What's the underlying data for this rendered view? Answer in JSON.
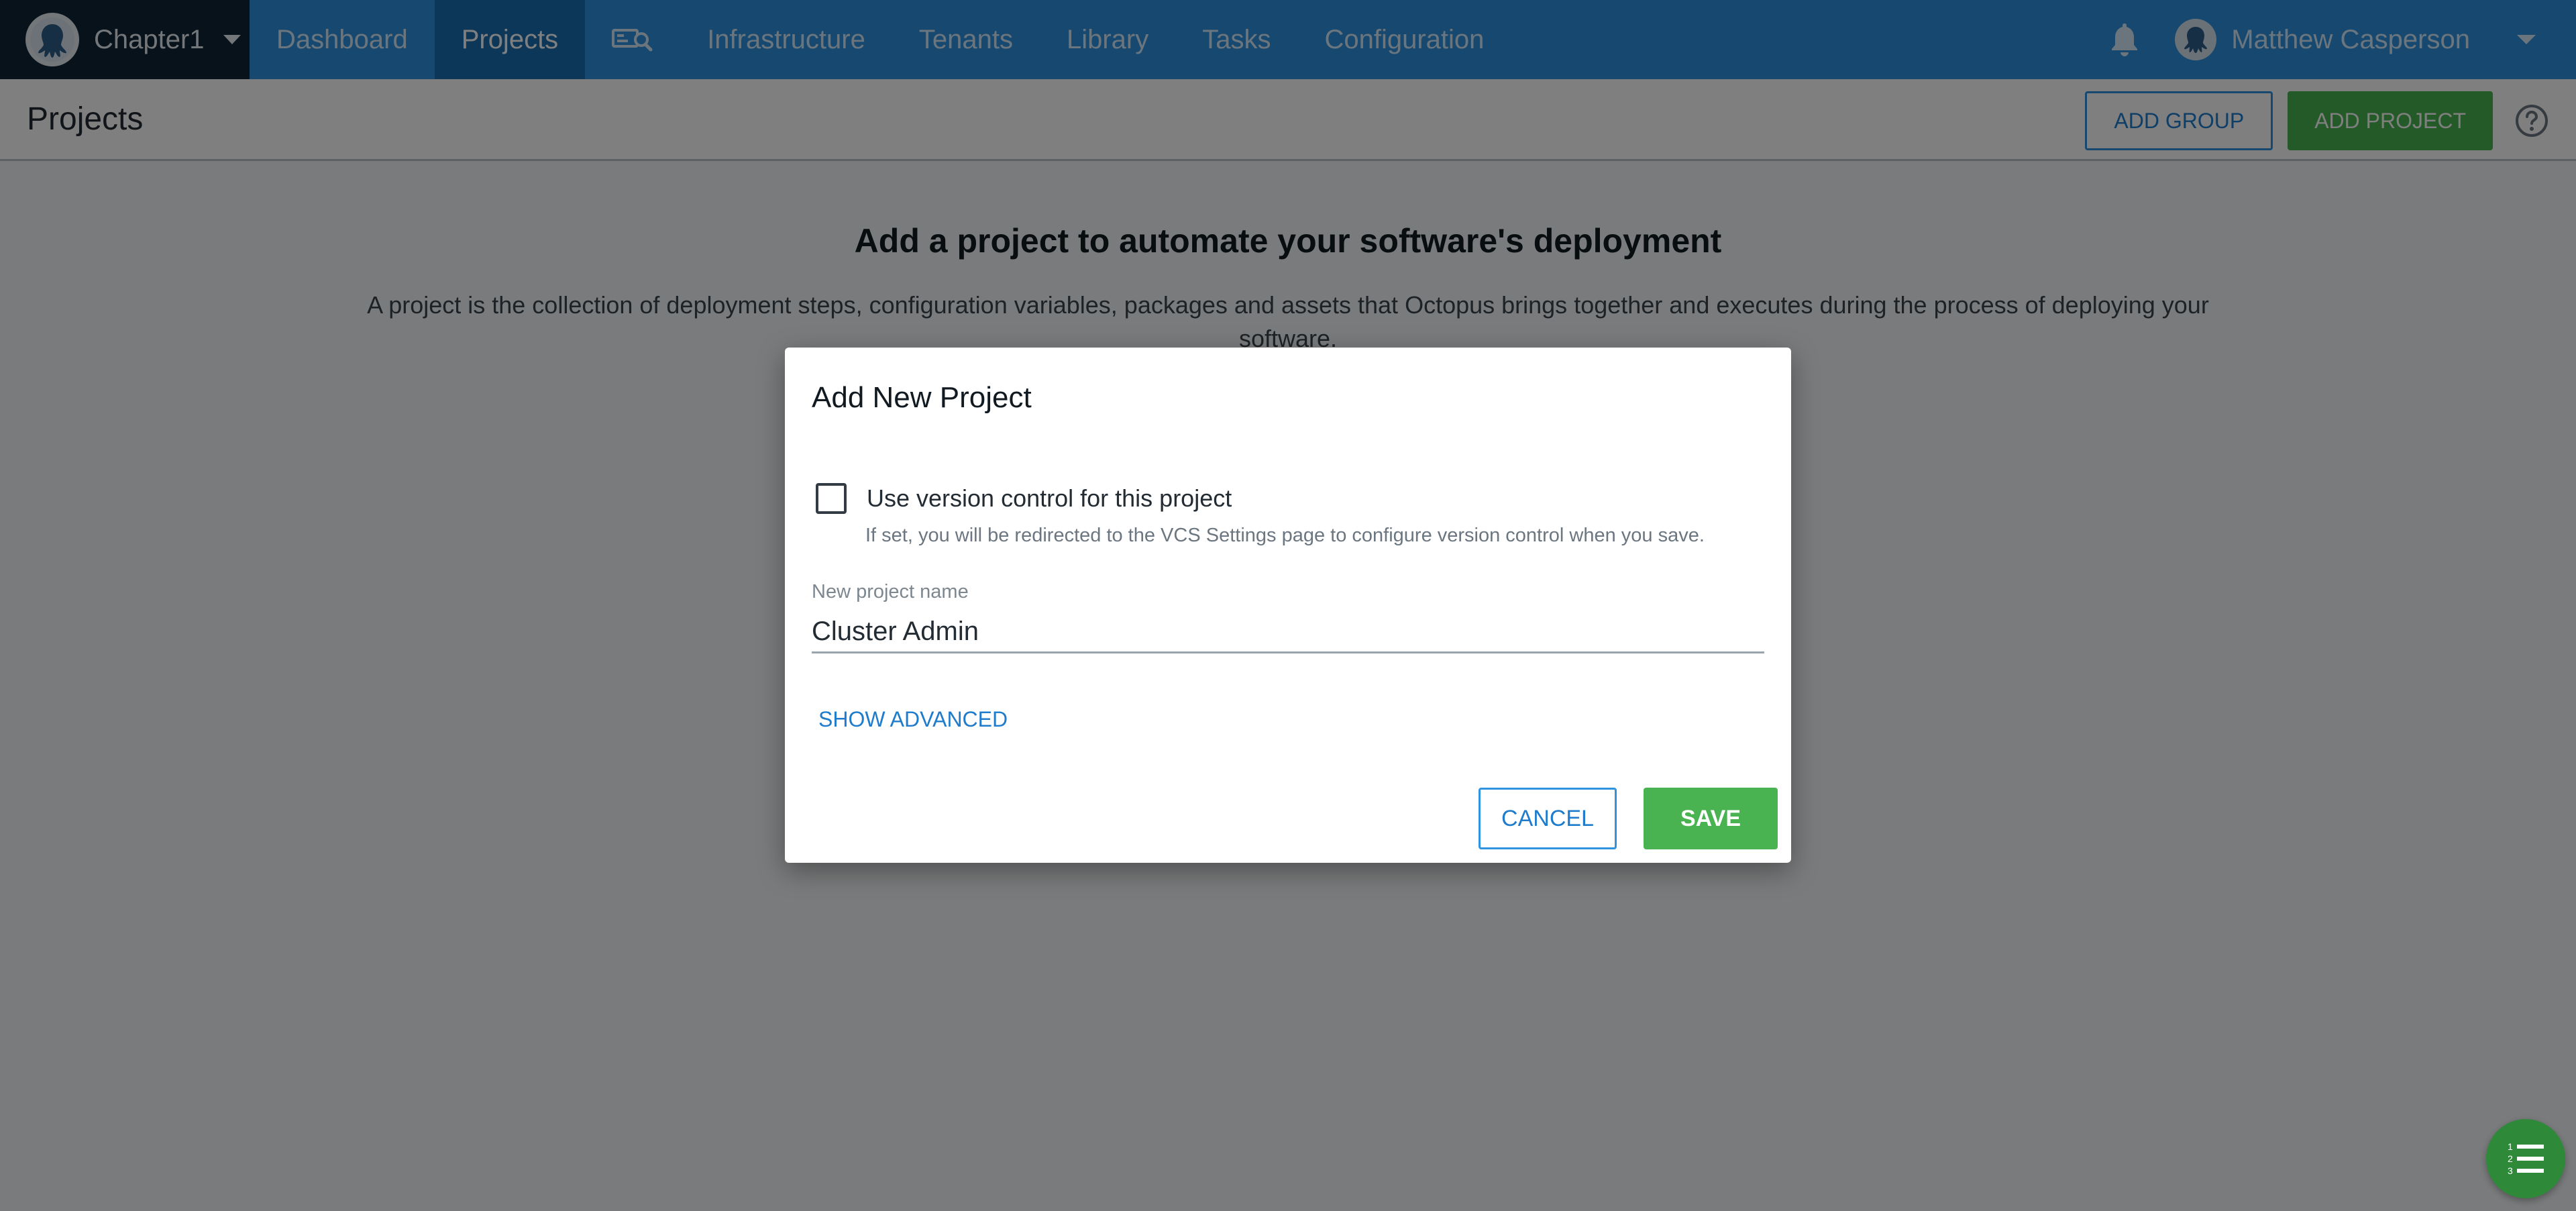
{
  "nav": {
    "space_name": "Chapter1",
    "items": [
      {
        "label": "Dashboard"
      },
      {
        "label": "Projects"
      },
      {
        "label": "Infrastructure"
      },
      {
        "label": "Tenants"
      },
      {
        "label": "Library"
      },
      {
        "label": "Tasks"
      },
      {
        "label": "Configuration"
      }
    ],
    "active_item": "Projects",
    "user_name": "Matthew Casperson"
  },
  "header": {
    "title": "Projects",
    "add_group_label": "ADD GROUP",
    "add_project_label": "ADD PROJECT"
  },
  "onboarding": {
    "heading": "Add a project to automate your software's deployment",
    "text": "A project is the collection of deployment steps, configuration variables, packages and assets that Octopus brings together and executes during the process of deploying your software."
  },
  "dialog": {
    "title": "Add New Project",
    "vcs_label": "Use version control for this project",
    "vcs_checked": false,
    "vcs_hint": "If set, you will be redirected to the VCS Settings page to configure version control when you save.",
    "name_label": "New project name",
    "name_value": "Cluster Admin",
    "show_advanced_label": "SHOW ADVANCED",
    "cancel_label": "CANCEL",
    "save_label": "SAVE"
  },
  "colors": {
    "nav_bg": "#2f93e0",
    "nav_active": "#1a6fb3",
    "space_bg": "#0f2535",
    "primary_blue": "#1f7ccc",
    "green": "#48b350"
  },
  "icons": {
    "space_avatar": "octopus-avatar-icon",
    "search_machines": "machine-search-icon",
    "notifications": "bell-icon",
    "user_avatar": "user-avatar-icon",
    "help": "help-circle-icon",
    "tasks": "task-list-icon"
  }
}
